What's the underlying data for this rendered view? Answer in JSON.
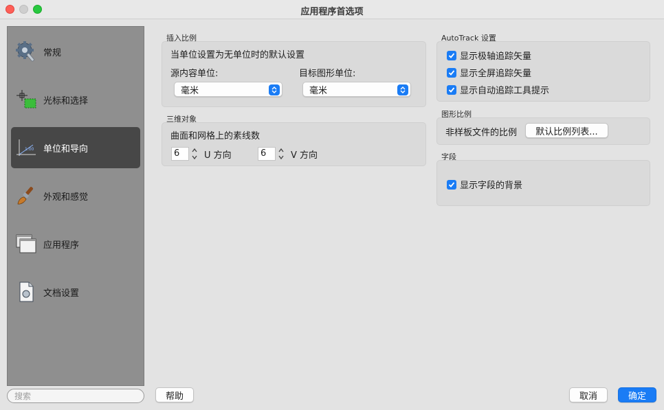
{
  "window": {
    "title": "应用程序首选项"
  },
  "sidebar": {
    "items": [
      {
        "label": "常规",
        "icon": "gear-icon"
      },
      {
        "label": "光标和选择",
        "icon": "cursor-selection-icon"
      },
      {
        "label": "单位和导向",
        "icon": "units-ruler-icon",
        "selected": true
      },
      {
        "label": "外观和感觉",
        "icon": "paintbrush-icon"
      },
      {
        "label": "应用程序",
        "icon": "application-windows-icon"
      },
      {
        "label": "文档设置",
        "icon": "document-settings-icon"
      }
    ],
    "search_placeholder": "搜索"
  },
  "insert_scale": {
    "title": "插入比例",
    "description": "当单位设置为无单位时的默认设置",
    "source_label": "源内容单位:",
    "source_value": "毫米",
    "target_label": "目标图形单位:",
    "target_value": "毫米"
  },
  "three_d": {
    "title": "三维对象",
    "description": "曲面和网格上的素线数",
    "u_value": "6",
    "u_label": "U 方向",
    "v_value": "6",
    "v_label": "V 方向"
  },
  "autotrack": {
    "title": "AutoTrack 设置",
    "options": [
      {
        "label": "显示极轴追踪矢量",
        "checked": true
      },
      {
        "label": "显示全屏追踪矢量",
        "checked": true
      },
      {
        "label": "显示自动追踪工具提示",
        "checked": true
      }
    ]
  },
  "drawing_scale": {
    "title": "图形比例",
    "label": "非样板文件的比例",
    "button": "默认比例列表..."
  },
  "fields": {
    "title": "字段",
    "option": {
      "label": "显示字段的背景",
      "checked": true
    }
  },
  "footer": {
    "help": "帮助",
    "cancel": "取消",
    "ok": "确定"
  },
  "colors": {
    "accent": "#1a7cf5",
    "sidebar_bg": "#8f8f8f",
    "sidebar_selected": "#474747"
  }
}
